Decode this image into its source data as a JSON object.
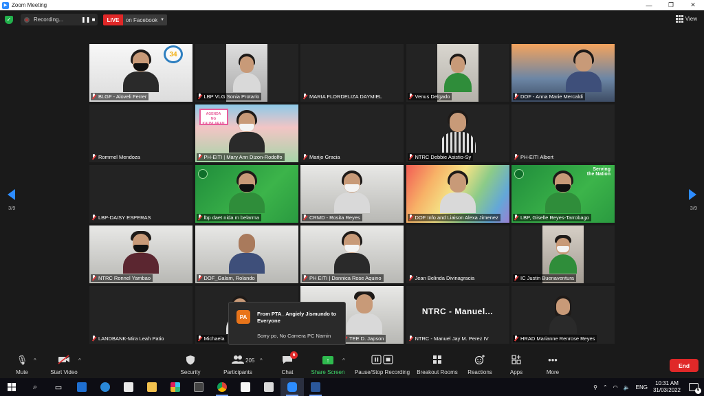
{
  "window": {
    "title": "Zoom Meeting",
    "minimize": "—",
    "maximize": "❐",
    "close": "✕"
  },
  "topbar": {
    "recording_label": "Recording...",
    "pause": "❚❚",
    "stop": "■",
    "live_label": "LIVE",
    "live_target": "on Facebook",
    "view_label": "View"
  },
  "paging": {
    "left": "3/9",
    "right": "3/9"
  },
  "tiles": [
    {
      "name": "BLGF - Aloveli Ferrer",
      "style": "cam"
    },
    {
      "name": "LBP VLG Sonia Protarlo",
      "style": "cam"
    },
    {
      "name": "MARIA FLORDELIZA DAYMIEL",
      "style": "none"
    },
    {
      "name": "Venus Delgado",
      "style": "cam"
    },
    {
      "name": "DOF - Anna Marie Mercaldi",
      "style": "cam"
    },
    {
      "name": "Rommel Mendoza",
      "style": "none"
    },
    {
      "name": "PH-EITI | Mary Ann Dizon-Rodolfo",
      "style": "cam"
    },
    {
      "name": "Marijo Gracia",
      "style": "none"
    },
    {
      "name": "NTRC Debbie Asistio-Sy",
      "style": "cam"
    },
    {
      "name": "PH-EITI Albert",
      "style": "none"
    },
    {
      "name": "LBP-DAISY ESPERAS",
      "style": "none"
    },
    {
      "name": "lbp daet nida m belarma",
      "style": "cam"
    },
    {
      "name": "CRMD - Rosita Reyes",
      "style": "cam"
    },
    {
      "name": "DOF Info and Liaison Alexa Jimenez",
      "style": "cam"
    },
    {
      "name": "LBP, Giselle Reyes-Tarrobago",
      "style": "cam"
    },
    {
      "name": "NTRC Ronnel Yambao",
      "style": "cam"
    },
    {
      "name": "DOF_Galam, Rolando",
      "style": "cam"
    },
    {
      "name": "PH EITI | Dannica Rose Aquino",
      "style": "cam"
    },
    {
      "name": "Jean Belinda Divinagracia",
      "style": "none"
    },
    {
      "name": "IC Justin Buenaventura",
      "style": "cam"
    },
    {
      "name": "LANDBANK-Mira Leah Patio",
      "style": "none"
    },
    {
      "name": "Michaela",
      "style": "cam"
    },
    {
      "name": "TEE D. Japson",
      "style": "cam"
    },
    {
      "name": "NTRC - Manuel Jay M. Perez IV",
      "style": "none"
    },
    {
      "name": "HRAD Marianne Renrose Reyes",
      "style": "cam"
    }
  ],
  "tile_overlays": {
    "serving_line1": "Serving",
    "serving_line2": "the Nation",
    "ntrc_text": "NTRC - Manuel...",
    "logo_34": "34"
  },
  "chat_popup": {
    "avatar": "PA",
    "from": "From PTA_ Angiely Jismundo to Everyone",
    "message": "Sorry po, No Camera PC Namin"
  },
  "toolbar": {
    "mute": "Mute",
    "start_video": "Start Video",
    "security": "Security",
    "participants": "Participants",
    "participants_count": "205",
    "chat": "Chat",
    "chat_badge": "6",
    "share_screen": "Share Screen",
    "pause_stop_recording": "Pause/Stop Recording",
    "breakout_rooms": "Breakout Rooms",
    "reactions": "Reactions",
    "apps": "Apps",
    "more": "More",
    "end": "End"
  },
  "taskbar": {
    "language": "ENG",
    "time": "10:31 AM",
    "date": "31/03/2022",
    "notifications": "5"
  },
  "colors": {
    "zoom_blue": "#2d8cff",
    "live_red": "#e02828",
    "share_green": "#2fbb4f",
    "background": "#1a1a1a"
  }
}
